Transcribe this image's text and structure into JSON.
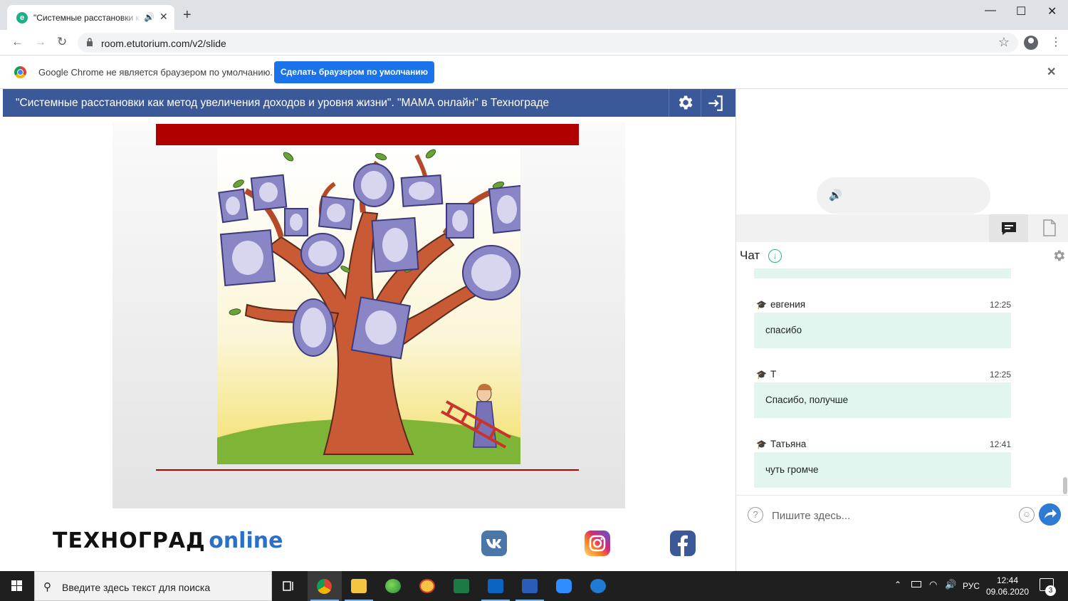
{
  "browser": {
    "tab_title": "\"Системные расстановки ка",
    "new_tab": "+",
    "window_controls": {
      "minimize": "—",
      "maximize": "☐",
      "close": "✕"
    },
    "url": "room.etutorium.com/v2/slide",
    "infobar": {
      "message": "Google Chrome не является браузером по умолчанию.",
      "button": "Сделать браузером по умолчанию",
      "close": "✕"
    }
  },
  "page": {
    "header_title": "\"Системные расстановки как метод увеличения доходов и уровня жизни\". \"МАМА онлайн\" в Технограде",
    "footer_brand": "ТЕХНОГРАД",
    "footer_online": "online",
    "social_icons": [
      "vk-icon",
      "instagram-icon",
      "facebook-icon"
    ],
    "slide_colors": {
      "accent_red": "#b00000",
      "header_blue": "#3b5998"
    }
  },
  "chat": {
    "title": "Чат",
    "messages": [
      {
        "author": "евгения",
        "time": "12:25",
        "text": "спасибо"
      },
      {
        "author": "Т",
        "time": "12:25",
        "text": "Спасибо, получше"
      },
      {
        "author": "Татьяна",
        "time": "12:41",
        "text": "чуть громче"
      }
    ],
    "input_placeholder": "Пишите здесь...",
    "bubble_color": "#e2f6ef"
  },
  "taskbar": {
    "search_placeholder": "Введите здесь текст для поиска",
    "language": "РУС",
    "time": "12:44",
    "date": "09.06.2020",
    "notification_count": "3"
  }
}
